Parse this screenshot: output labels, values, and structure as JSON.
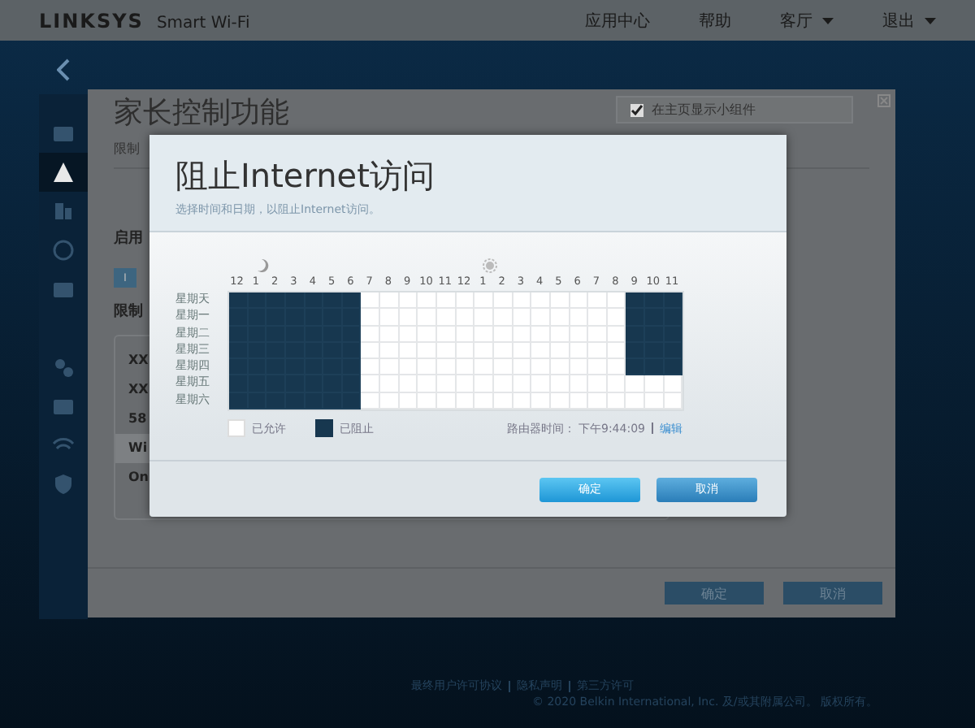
{
  "header": {
    "logo": "LINKSYS",
    "product": "Smart Wi-Fi",
    "nav": [
      {
        "label": "应用中心",
        "dropdown": false
      },
      {
        "label": "帮助",
        "dropdown": false
      },
      {
        "label": "客厅",
        "dropdown": true
      },
      {
        "label": "退出",
        "dropdown": true
      }
    ]
  },
  "sidebar": {
    "items": [
      {
        "selected": false
      },
      {
        "selected": true
      },
      {
        "selected": false
      },
      {
        "selected": false
      },
      {
        "selected": false
      },
      {
        "selected": false
      },
      {
        "selected": false
      },
      {
        "selected": false
      },
      {
        "selected": false
      }
    ]
  },
  "background_dialog": {
    "title": "家长控制功能",
    "subtitle": "限制",
    "widget_checkbox": {
      "label": "在主页显示小组件",
      "checked": true
    },
    "enable_label": "启用",
    "toggle": {
      "label": "I",
      "on": true
    },
    "restrict_label": "限制",
    "devices": [
      {
        "name": "XX",
        "selected": false
      },
      {
        "name": "XX",
        "selected": false
      },
      {
        "name": "58",
        "selected": false
      },
      {
        "name": "Wi",
        "selected": true
      },
      {
        "name": "On",
        "selected": false
      }
    ],
    "buttons": [
      "确定",
      "取消"
    ]
  },
  "modal": {
    "title": "阻止Internet访问",
    "subtitle": "选择时间和日期，以阻止Internet访问。",
    "hours": [
      "12",
      "1",
      "2",
      "3",
      "4",
      "5",
      "6",
      "7",
      "8",
      "9",
      "10",
      "11",
      "12",
      "1",
      "2",
      "3",
      "4",
      "5",
      "6",
      "7",
      "8",
      "9",
      "10",
      "11"
    ],
    "days": [
      {
        "label": "星期天",
        "blocked": [
          true,
          true,
          true,
          true,
          true,
          true,
          true,
          false,
          false,
          false,
          false,
          false,
          false,
          false,
          false,
          false,
          false,
          false,
          false,
          false,
          false,
          true,
          true,
          true
        ]
      },
      {
        "label": "星期一",
        "blocked": [
          true,
          true,
          true,
          true,
          true,
          true,
          true,
          false,
          false,
          false,
          false,
          false,
          false,
          false,
          false,
          false,
          false,
          false,
          false,
          false,
          false,
          true,
          true,
          true
        ]
      },
      {
        "label": "星期二",
        "blocked": [
          true,
          true,
          true,
          true,
          true,
          true,
          true,
          false,
          false,
          false,
          false,
          false,
          false,
          false,
          false,
          false,
          false,
          false,
          false,
          false,
          false,
          true,
          true,
          true
        ]
      },
      {
        "label": "星期三",
        "blocked": [
          true,
          true,
          true,
          true,
          true,
          true,
          true,
          false,
          false,
          false,
          false,
          false,
          false,
          false,
          false,
          false,
          false,
          false,
          false,
          false,
          false,
          true,
          true,
          true
        ]
      },
      {
        "label": "星期四",
        "blocked": [
          true,
          true,
          true,
          true,
          true,
          true,
          true,
          false,
          false,
          false,
          false,
          false,
          false,
          false,
          false,
          false,
          false,
          false,
          false,
          false,
          false,
          true,
          true,
          true
        ]
      },
      {
        "label": "星期五",
        "blocked": [
          true,
          true,
          true,
          true,
          true,
          true,
          true,
          false,
          false,
          false,
          false,
          false,
          false,
          false,
          false,
          false,
          false,
          false,
          false,
          false,
          false,
          false,
          false,
          false
        ]
      },
      {
        "label": "星期六",
        "blocked": [
          true,
          true,
          true,
          true,
          true,
          true,
          true,
          false,
          false,
          false,
          false,
          false,
          false,
          false,
          false,
          false,
          false,
          false,
          false,
          false,
          false,
          false,
          false,
          false
        ]
      }
    ],
    "legend": [
      {
        "label": "已允许",
        "blocked": false
      },
      {
        "label": "已阻止",
        "blocked": true
      }
    ],
    "router_time_label": "路由器时间：",
    "router_time": "下午9:44:09",
    "edit_link": "编辑",
    "buttons": [
      {
        "label": "确定",
        "primary": true
      },
      {
        "label": "取消",
        "primary": false
      }
    ]
  },
  "footer": {
    "links": [
      "最终用户许可协议",
      "隐私声明",
      "第三方许可"
    ],
    "copyright": "© 2020 Belkin International, Inc. 及/或其附属公司。 版权所有。"
  }
}
